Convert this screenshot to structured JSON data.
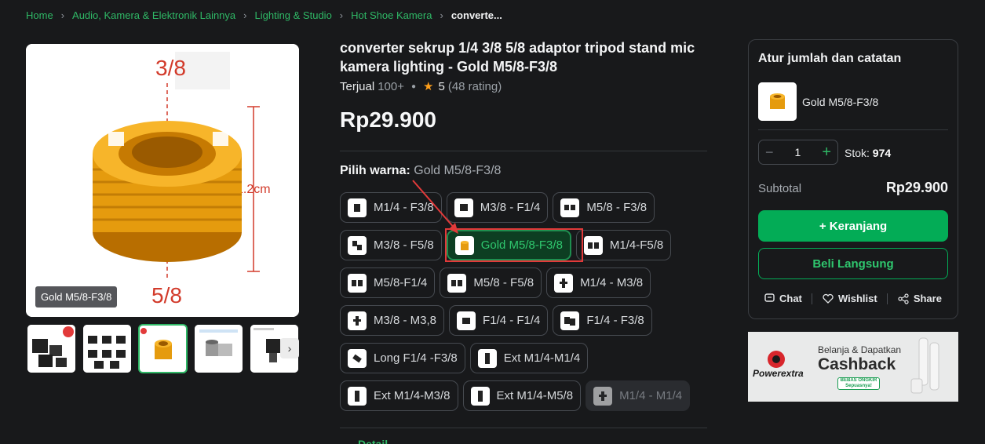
{
  "breadcrumb": {
    "items": [
      "Home",
      "Audio, Kamera & Elektronik Lainnya",
      "Lighting & Studio",
      "Hot Shoe Kamera"
    ],
    "current": "converte..."
  },
  "gallery": {
    "caption": "Gold M5/8-F3/8",
    "label_top": "3/8",
    "label_side": "1.2cm",
    "label_bottom": "5/8",
    "thumbnail_count": 5,
    "active_thumbnail": 3
  },
  "product": {
    "title": "converter sekrup 1/4 3/8 5/8 adaptor tripod stand mic kamera lighting - Gold M5/8-F3/8",
    "sold_label": "Terjual",
    "sold_count": "100+",
    "rating": "5",
    "rating_count": "(48 rating)",
    "price": "Rp29.900"
  },
  "variant": {
    "label": "Pilih warna:",
    "selected": "Gold M5/8-F3/8",
    "options": [
      "M1/4 - F3/8",
      "M3/8 - F1/4",
      "M5/8 - F3/8",
      "M3/8 - F5/8",
      "Gold M5/8-F3/8",
      "M1/4-F5/8",
      "M5/8-F1/4",
      "M5/8 - F5/8",
      "M1/4 - M3/8",
      "M3/8 - M3,8",
      "F1/4 - F1/4",
      "F1/4 - F3/8",
      "Long F1/4 -F3/8",
      "Ext M1/4-M1/4",
      "Ext M1/4-M3/8",
      "Ext M1/4-M5/8",
      "M1/4 - M1/4"
    ]
  },
  "details_tab": "Detail",
  "cart_card": {
    "title": "Atur jumlah dan catatan",
    "variant": "Gold M5/8-F3/8",
    "quantity": "1",
    "stock_label": "Stok:",
    "stock_value": "974",
    "subtotal_label": "Subtotal",
    "subtotal_value": "Rp29.900",
    "add_to_cart": "+ Keranjang",
    "buy_now": "Beli Langsung",
    "chat": "Chat",
    "wishlist": "Wishlist",
    "share": "Share"
  },
  "banner": {
    "brand": "Powerextra",
    "line1": "Belanja & Dapatkan",
    "line2": "Cashback",
    "badge": "BEBAS ONGKIR Sepuasnya!"
  },
  "colors": {
    "accent": "#03ac56",
    "selected_bg": "#0d3e22",
    "background": "#18191b",
    "highlight": "#e23a3a"
  }
}
